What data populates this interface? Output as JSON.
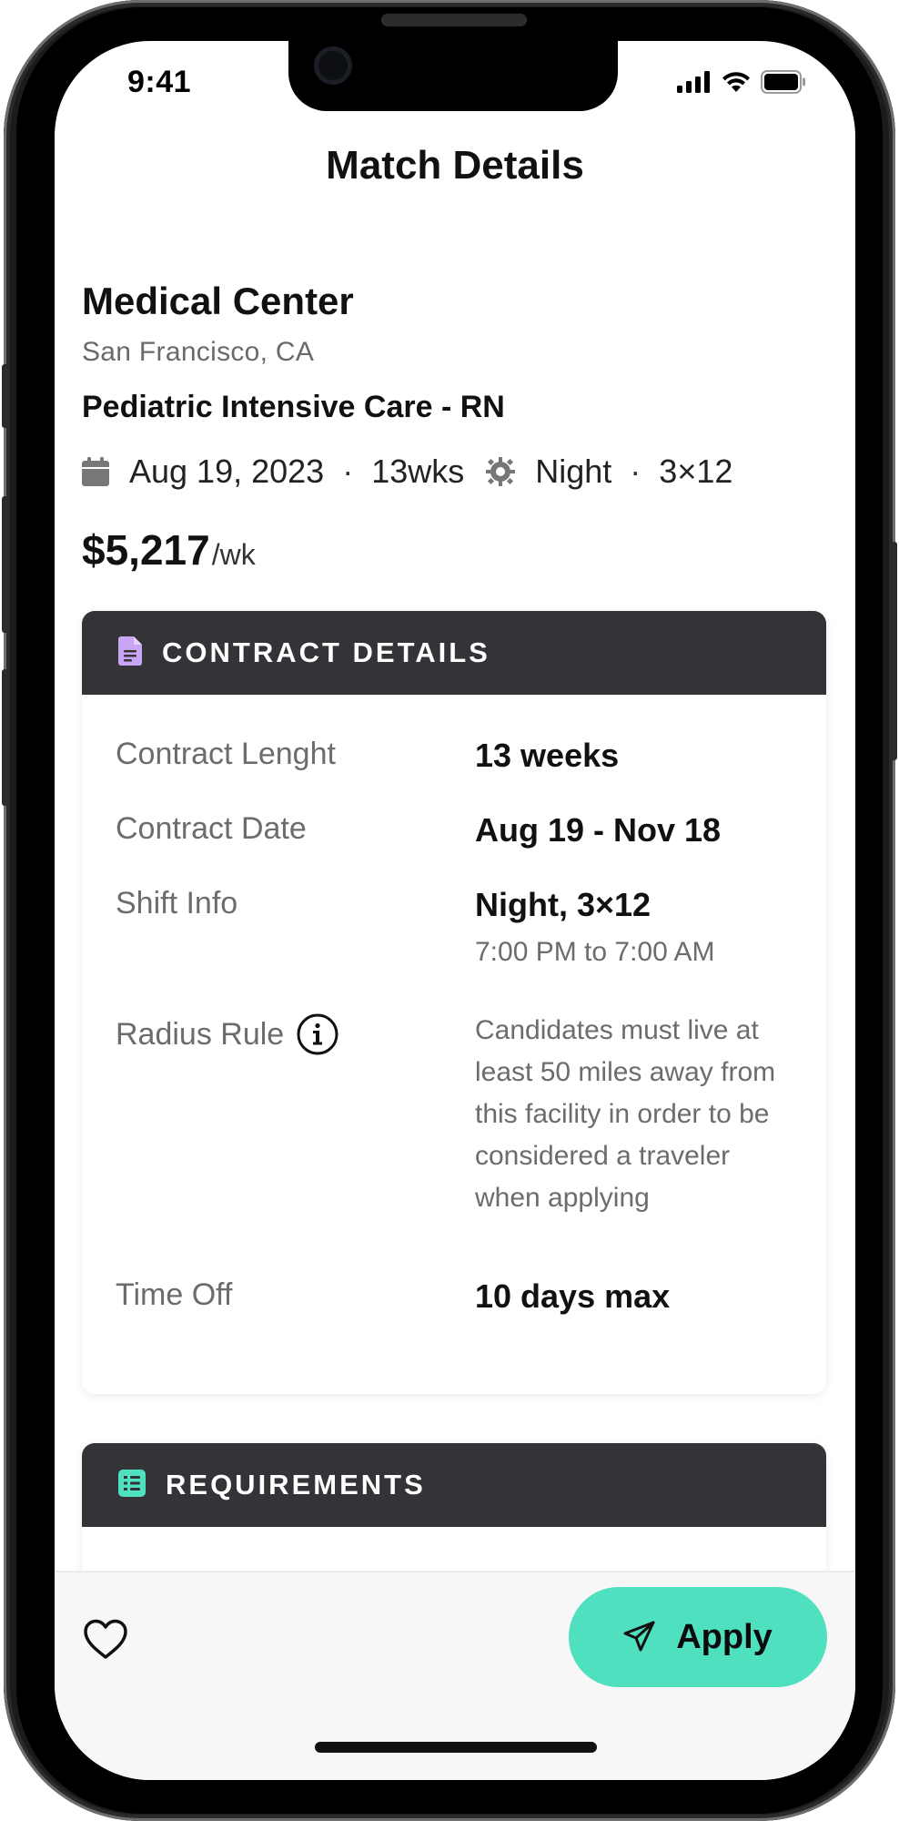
{
  "status_bar": {
    "time": "9:41"
  },
  "header": {
    "title": "Match Details"
  },
  "summary": {
    "facility_name": "Medical Center",
    "location": "San Francisco, CA",
    "job_title": "Pediatric Intensive Care - RN",
    "start_date": "Aug 19, 2023",
    "duration": "13wks",
    "shift": "Night",
    "schedule": "3×12",
    "separator": "·",
    "pay_amount": "$5,217",
    "pay_unit": "/wk"
  },
  "contract_card": {
    "title": "CONTRACT DETAILS",
    "rows": {
      "length_label": "Contract Lenght",
      "length_value": "13 weeks",
      "date_label": "Contract Date",
      "date_value": "Aug 19 - Nov 18",
      "shift_label": "Shift Info",
      "shift_value": "Night, 3×12",
      "shift_hours": "7:00 PM to 7:00 AM",
      "radius_label": "Radius Rule",
      "radius_value": "Candidates must live at least 50 miles away from this facility in order to be considered a traveler when applying",
      "timeoff_label": "Time Off",
      "timeoff_value": "10 days max"
    }
  },
  "requirements_card": {
    "title": "REQUIREMENTS"
  },
  "bottom_bar": {
    "apply_label": "Apply"
  },
  "colors": {
    "accent": "#4fe0bf",
    "card_header": "#343438",
    "contract_icon": "#c9a6f5",
    "requirements_icon": "#4fe0bf"
  },
  "icons": [
    "signal-icon",
    "wifi-icon",
    "battery-icon",
    "calendar-icon",
    "sun-icon",
    "document-icon",
    "info-icon",
    "checklist-icon",
    "heart-icon",
    "send-icon"
  ]
}
